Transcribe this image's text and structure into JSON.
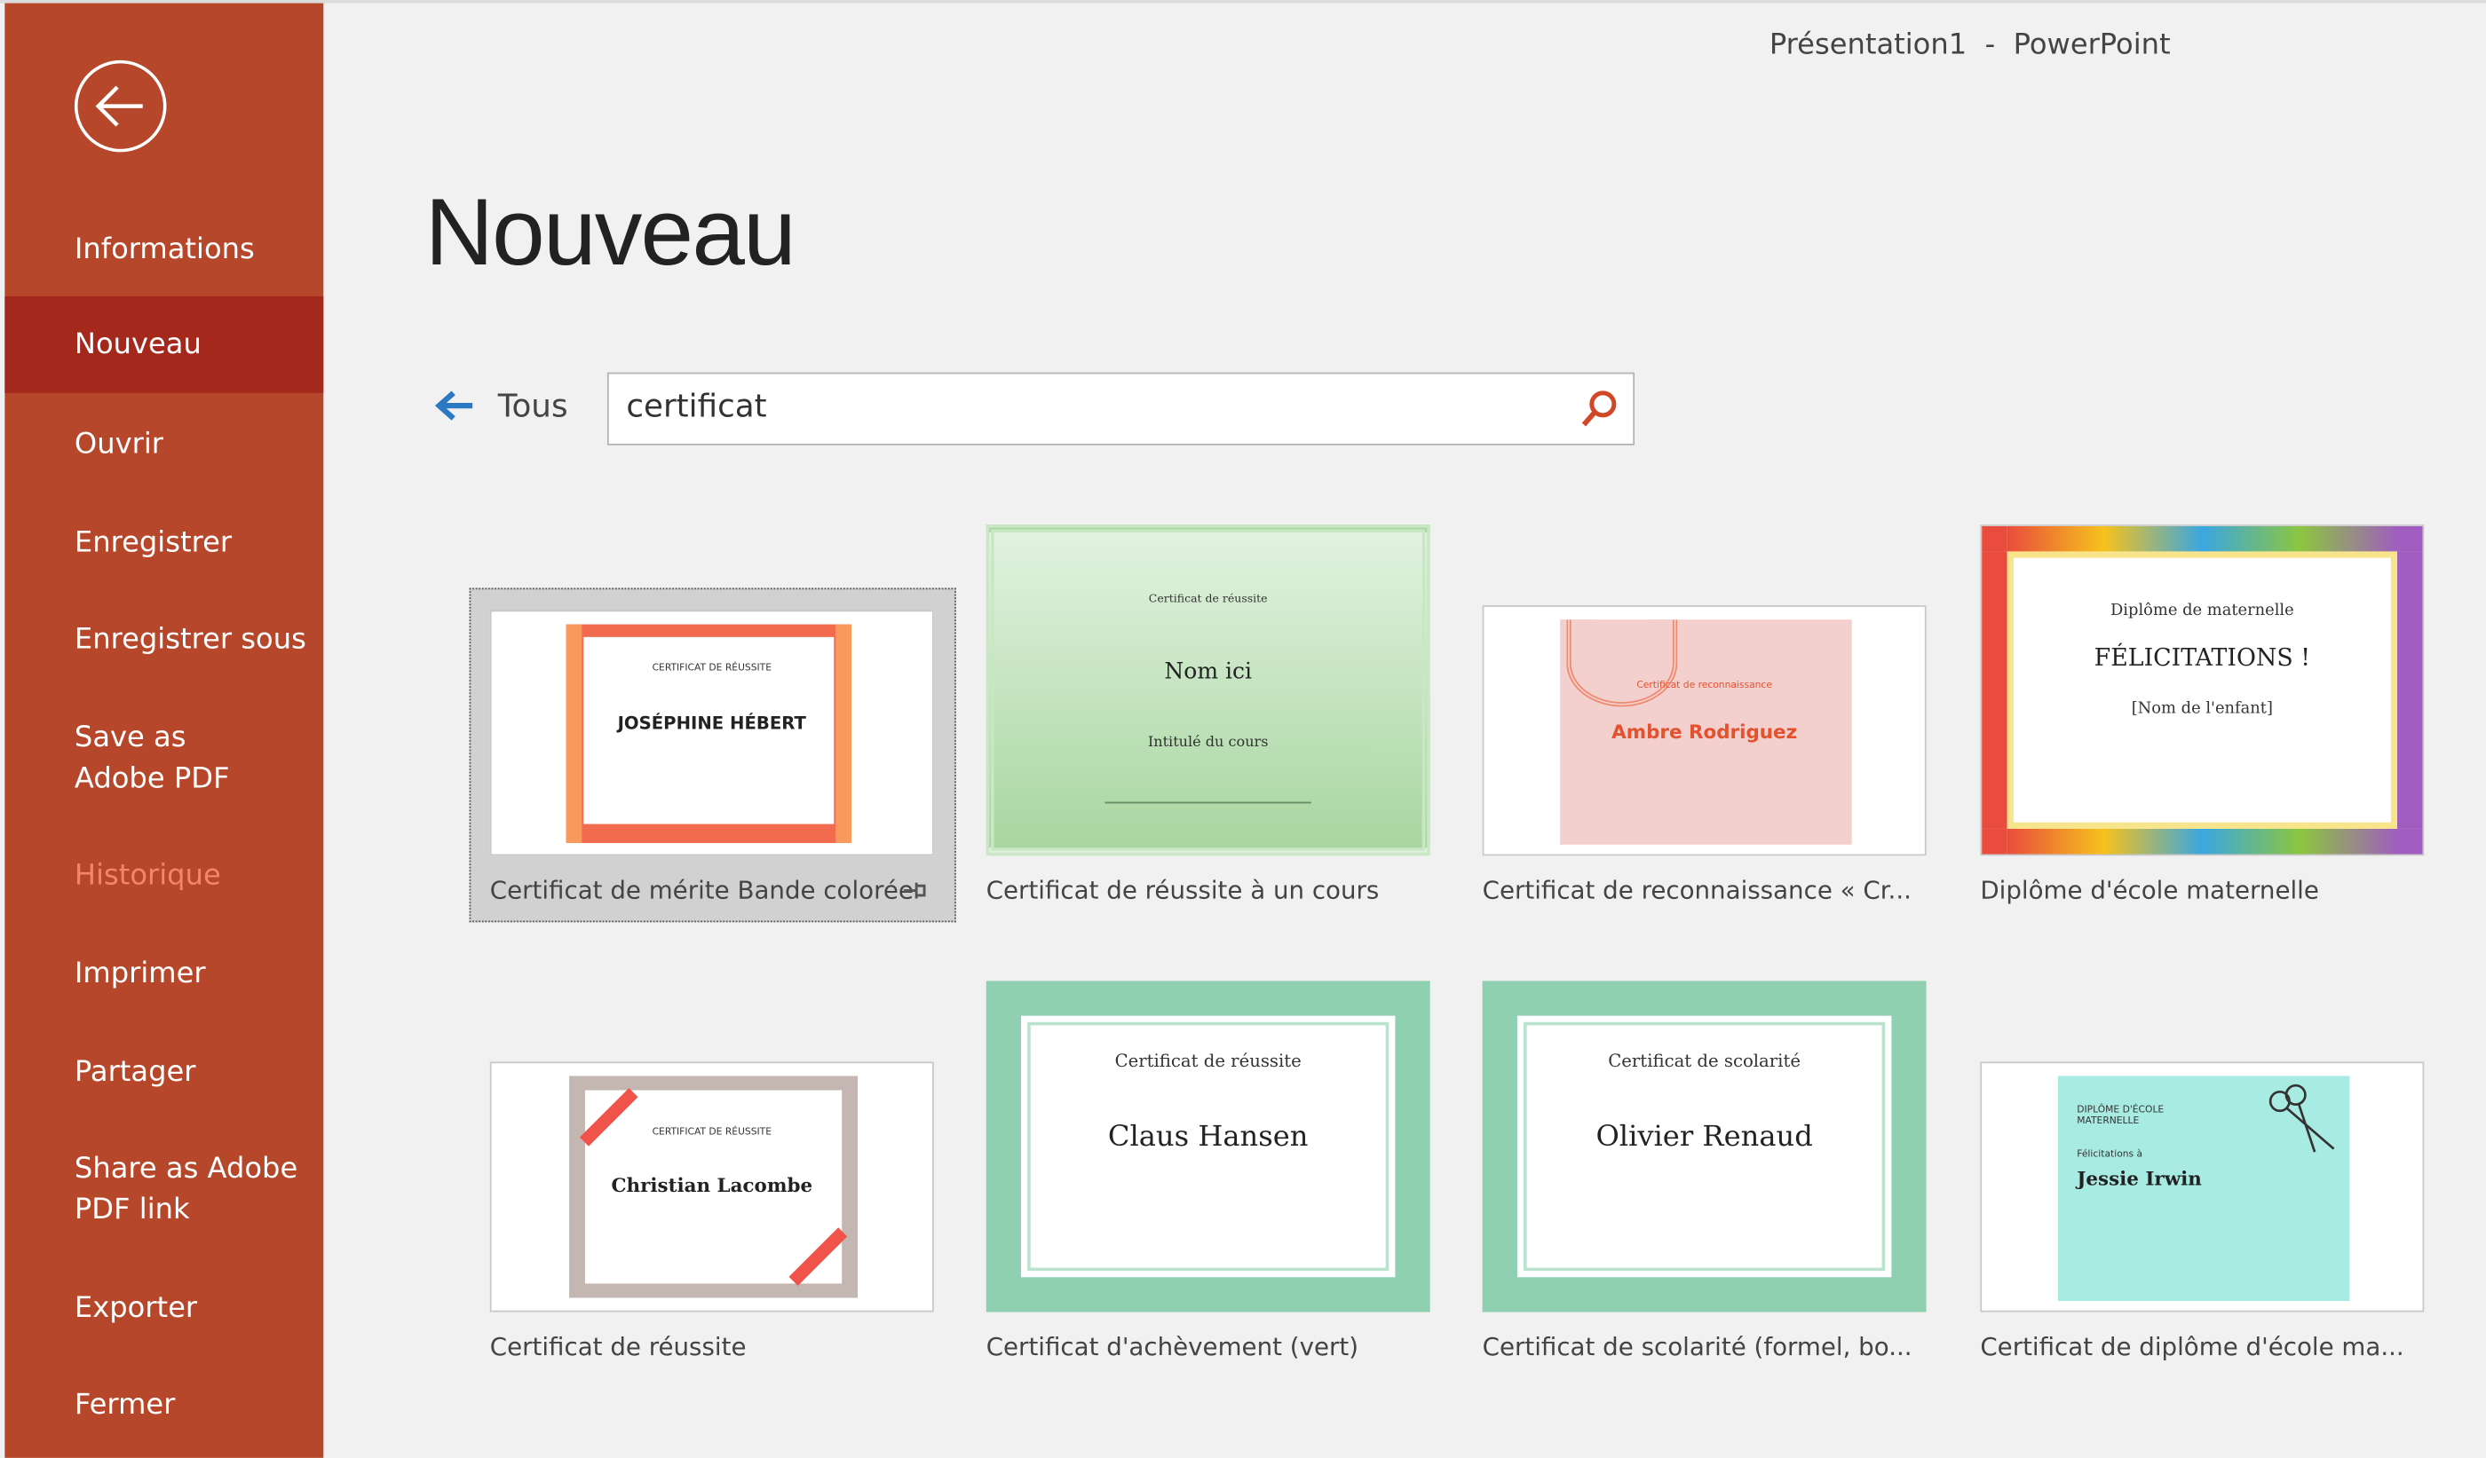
{
  "window": {
    "title": "Présentation1  -  PowerPoint"
  },
  "sidebar": {
    "back_icon": "arrow-left-circle-icon",
    "items": [
      {
        "label": "Informations"
      },
      {
        "label": "Nouveau",
        "selected": true
      },
      {
        "label": "Ouvrir"
      },
      {
        "label": "Enregistrer"
      },
      {
        "label": "Enregistrer sous"
      },
      {
        "label": "Save as Adobe PDF"
      },
      {
        "label": "Historique",
        "disabled": true
      },
      {
        "label": "Imprimer"
      },
      {
        "label": "Partager"
      },
      {
        "label": "Share as Adobe PDF link"
      },
      {
        "label": "Exporter"
      },
      {
        "label": "Fermer"
      }
    ]
  },
  "colors": {
    "sidebar": "#b7472a",
    "sidebar_selected": "#a4291c",
    "accent_search": "#d24726",
    "back_arrow": "#2b79c2"
  },
  "main": {
    "title": "Nouveau",
    "back_label": "Tous",
    "search_value": "certificat",
    "templates": [
      {
        "label": "Certificat de mérite Bande colorée",
        "selected": true,
        "pinned": true,
        "thumb": {
          "l1": "CERTIFICAT DE RÉUSSITE",
          "l2": "JOSÉPHINE HÉBERT"
        }
      },
      {
        "label": "Certificat de réussite à un cours",
        "thumb": {
          "l1": "Certificat de réussite",
          "l2": "Nom ici",
          "l3": "Intitulé du cours"
        }
      },
      {
        "label": "Certificat de reconnaissance « Cr...",
        "thumb": {
          "l1": "Certificat de reconnaissance",
          "l2": "Ambre Rodriguez"
        }
      },
      {
        "label": "Diplôme d'école maternelle",
        "thumb": {
          "l1": "Diplôme de maternelle",
          "l2": "FÉLICITATIONS !",
          "l3": "[Nom de l'enfant]"
        }
      },
      {
        "label": "Certificat de réussite",
        "thumb": {
          "l1": "CERTIFICAT DE RÉUSSITE",
          "l2": "Christian Lacombe"
        }
      },
      {
        "label": "Certificat d'achèvement (vert)",
        "thumb": {
          "l1": "Certificat de réussite",
          "l2": "Claus Hansen"
        }
      },
      {
        "label": "Certificat de scolarité (formel, bo...",
        "thumb": {
          "l1": "Certificat de scolarité",
          "l2": "Olivier Renaud"
        }
      },
      {
        "label": "Certificat de diplôme d'école ma...",
        "thumb": {
          "l1": "DIPLÔME D'ÉCOLE MATERNELLE",
          "l2": "Félicitations à",
          "l3": "Jessie Irwin"
        }
      }
    ]
  }
}
